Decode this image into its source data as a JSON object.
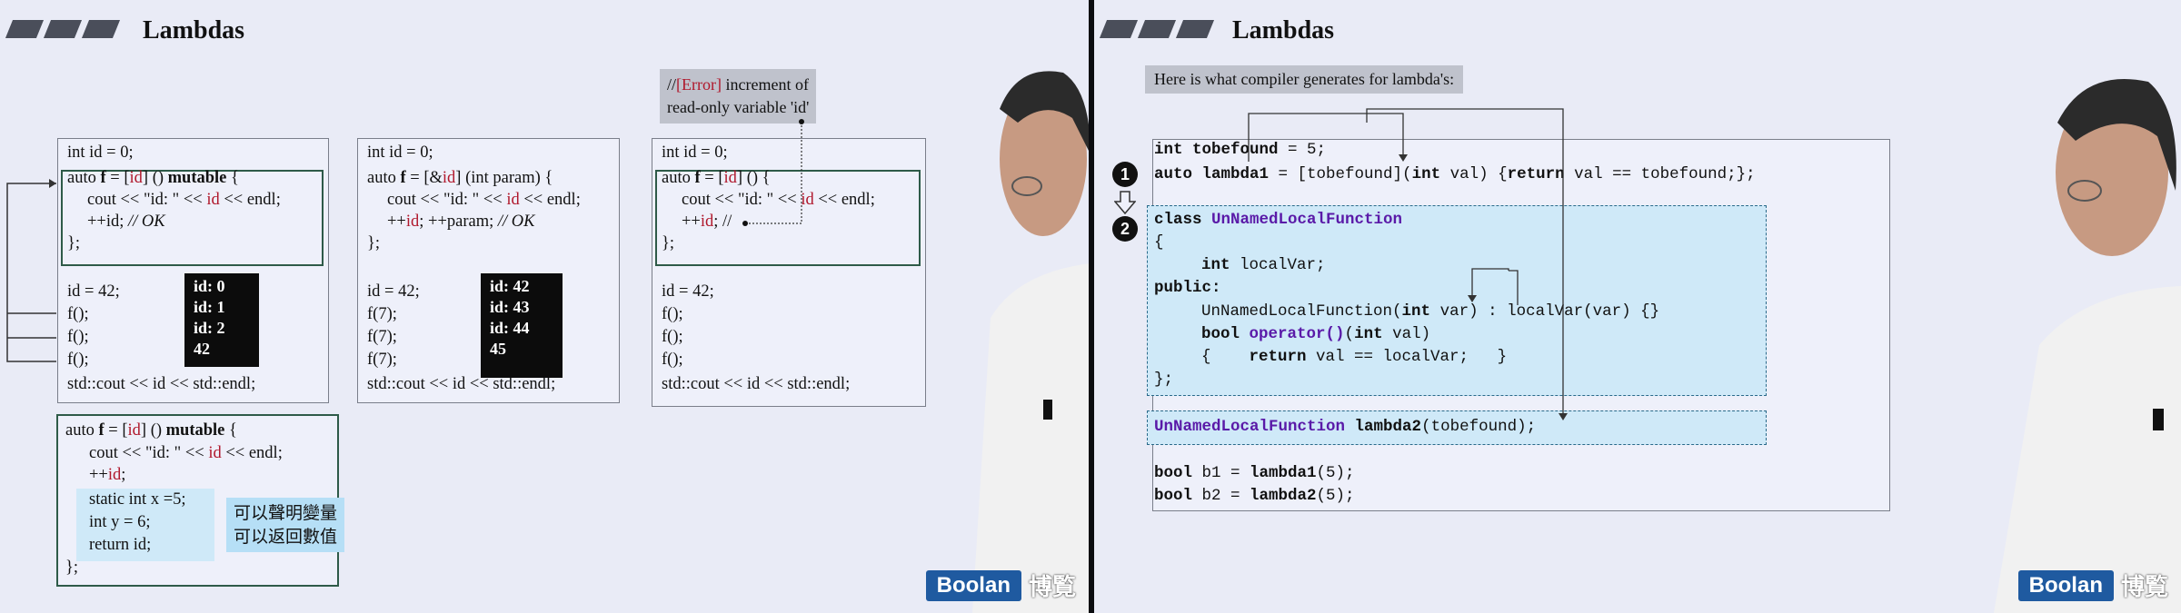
{
  "left": {
    "title": "Lambdas",
    "box1": {
      "lines": [
        "int id = 0;",
        "auto ",
        "f",
        " = [",
        "id",
        "] () ",
        "mutable",
        " {",
        "cout << \"id: \" << ",
        "id",
        " << endl;",
        "++id; ",
        "// OK",
        "};",
        "id = 42;",
        "f();",
        "f();",
        "f();",
        "std::cout << id << std::endl;"
      ],
      "output": [
        "id: 0",
        "id: 1",
        "id: 2",
        "42"
      ]
    },
    "box2": {
      "lines": [
        "int id = 0;",
        "auto ",
        "f",
        " = [&",
        "id",
        "] (int param) {",
        "cout << \"id: \" << ",
        "id",
        " << endl;",
        "++",
        "id",
        "; ++param; ",
        "// OK",
        "};",
        "id = 42;",
        "f(7);",
        "f(7);",
        "f(7);",
        "std::cout << id << std::endl;"
      ],
      "output": [
        "id: 42",
        "id: 43",
        "id: 44",
        "45"
      ]
    },
    "box3": {
      "lines": [
        "int id = 0;",
        "auto ",
        "f",
        " = [",
        "id",
        "] () {",
        "cout << \"id: \" << ",
        "id",
        " << endl;",
        "++",
        "id",
        "; //",
        "};",
        "id = 42;",
        "f();",
        "f();",
        "f();",
        "std::cout << id << std::endl;"
      ],
      "note": [
        "//[Error] increment of",
        "read-only variable 'id'"
      ],
      "note_prefix": "//",
      "note_err": "[Error]",
      "note_rest": " increment of"
    },
    "box4": {
      "lines": [
        "auto ",
        "f",
        " = [",
        "id",
        "] () ",
        "mutable",
        " {",
        "cout << \"id: \" << ",
        "id",
        " << endl;",
        "++",
        "id",
        ";",
        "static int x =5;",
        "int y = 6;",
        "return id;",
        "};"
      ],
      "tag": [
        "可以聲明變量",
        "可以返回數值"
      ]
    },
    "logo": "Boolan",
    "logo_cn": "博覧"
  },
  "right": {
    "title": "Lambdas",
    "subtitle": "Here is what compiler generates for lambda's:",
    "steps": [
      "1",
      "2"
    ],
    "code": {
      "l1a": "int",
      "l1b": " tobefound",
      "l1c": " = 5;",
      "l2a": "auto",
      "l2b": " lambda1",
      "l2c": " = [tobefound](",
      "l2d": "int",
      "l2e": " val) {",
      "l2f": "return",
      "l2g": " val == tobefound;};",
      "l3a": "class",
      "l3b": " UnNamedLocalFunction",
      "l4": "{",
      "l5a": "int",
      "l5b": " localVar;",
      "l6": "public:",
      "l7a": "UnNamedLocalFunction(",
      "l7b": "int",
      "l7c": " var) : localVar(var) {}",
      "l8a": "bool",
      "l8b": " operator()",
      "l8c": "(",
      "l8d": "int",
      "l8e": " val)",
      "l9a": "{    ",
      "l9b": "return",
      "l9c": " val == localVar;   }",
      "l10": "};",
      "l11a": "UnNamedLocalFunction",
      "l11b": " lambda2",
      "l11c": "(tobefound);",
      "l12a": "bool",
      "l12b": " b1 = ",
      "l12c": "lambda1",
      "l12d": "(5);",
      "l13a": "bool",
      "l13b": " b2 = ",
      "l13c": "lambda2",
      "l13d": "(5);"
    },
    "logo": "Boolan",
    "logo_cn": "博覧"
  },
  "colors": {
    "slide_bg": "#e9ebf6",
    "highlight_border": "#2e5a48",
    "red": "#b0182c",
    "purple": "#5a1aa8",
    "cyan": "#cfe9f8",
    "logo_blue": "#1f5aa0"
  }
}
